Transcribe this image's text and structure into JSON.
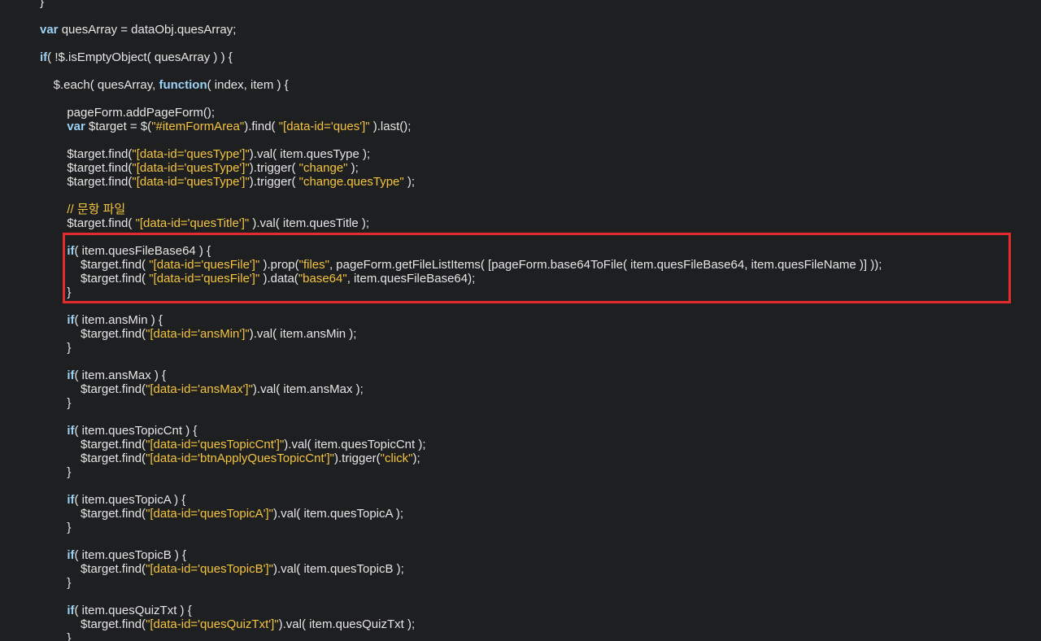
{
  "code_lines": [
    {
      "segments": [
        {
          "t": "}",
          "c": ""
        }
      ]
    },
    {
      "segments": []
    },
    {
      "segments": [
        {
          "t": "var",
          "c": "kw"
        },
        {
          "t": " quesArray = dataObj.quesArray;",
          "c": ""
        }
      ]
    },
    {
      "segments": []
    },
    {
      "segments": [
        {
          "t": "if",
          "c": "kw"
        },
        {
          "t": "( !$.isEmptyObject( quesArray ) ) {",
          "c": ""
        }
      ]
    },
    {
      "segments": []
    },
    {
      "segments": [
        {
          "t": "    $.each( quesArray, ",
          "c": ""
        },
        {
          "t": "function",
          "c": "kw"
        },
        {
          "t": "( index, item ) {",
          "c": ""
        }
      ]
    },
    {
      "segments": []
    },
    {
      "segments": [
        {
          "t": "        pageForm.addPageForm();",
          "c": ""
        }
      ]
    },
    {
      "segments": [
        {
          "t": "        ",
          "c": ""
        },
        {
          "t": "var",
          "c": "kw"
        },
        {
          "t": " $target = $(",
          "c": ""
        },
        {
          "t": "\"#itemFormArea\"",
          "c": "str"
        },
        {
          "t": ").find( ",
          "c": ""
        },
        {
          "t": "\"[data-id='ques']\"",
          "c": "str"
        },
        {
          "t": " ).last();",
          "c": ""
        }
      ]
    },
    {
      "segments": []
    },
    {
      "segments": [
        {
          "t": "        $target.find(",
          "c": ""
        },
        {
          "t": "\"[data-id='quesType']\"",
          "c": "str"
        },
        {
          "t": ").val( item.quesType );",
          "c": ""
        }
      ]
    },
    {
      "segments": [
        {
          "t": "        $target.find(",
          "c": ""
        },
        {
          "t": "\"[data-id='quesType']\"",
          "c": "str"
        },
        {
          "t": ").trigger( ",
          "c": ""
        },
        {
          "t": "\"change\"",
          "c": "str"
        },
        {
          "t": " );",
          "c": ""
        }
      ]
    },
    {
      "segments": [
        {
          "t": "        $target.find(",
          "c": ""
        },
        {
          "t": "\"[data-id='quesType']\"",
          "c": "str"
        },
        {
          "t": ").trigger( ",
          "c": ""
        },
        {
          "t": "\"change.quesType\"",
          "c": "str"
        },
        {
          "t": " );",
          "c": ""
        }
      ]
    },
    {
      "segments": []
    },
    {
      "segments": [
        {
          "t": "        // ",
          "c": "comment"
        },
        {
          "t": "문항 파일",
          "c": "comment kor"
        }
      ]
    },
    {
      "segments": [
        {
          "t": "        $target.find( ",
          "c": ""
        },
        {
          "t": "\"[data-id='quesTitle']\"",
          "c": "str"
        },
        {
          "t": " ).val( item.quesTitle );",
          "c": ""
        }
      ]
    },
    {
      "segments": []
    },
    {
      "segments": [
        {
          "t": "        ",
          "c": ""
        },
        {
          "t": "if",
          "c": "kw"
        },
        {
          "t": "( item.quesFileBase64 ) {",
          "c": ""
        }
      ]
    },
    {
      "segments": [
        {
          "t": "            $target.find( ",
          "c": ""
        },
        {
          "t": "\"[data-id='quesFile']\"",
          "c": "str"
        },
        {
          "t": " ).prop(",
          "c": ""
        },
        {
          "t": "\"files\"",
          "c": "str"
        },
        {
          "t": ", pageForm.getFileListItems( [pageForm.base64ToFile( item.quesFileBase64, item.quesFileName )] ));",
          "c": ""
        }
      ]
    },
    {
      "segments": [
        {
          "t": "            $target.find( ",
          "c": ""
        },
        {
          "t": "\"[data-id='quesFile']\"",
          "c": "str"
        },
        {
          "t": " ).data(",
          "c": ""
        },
        {
          "t": "\"base64\"",
          "c": "str"
        },
        {
          "t": ", item.quesFileBase64);",
          "c": ""
        }
      ]
    },
    {
      "segments": [
        {
          "t": "        }",
          "c": ""
        }
      ]
    },
    {
      "segments": []
    },
    {
      "segments": [
        {
          "t": "        ",
          "c": ""
        },
        {
          "t": "if",
          "c": "kw"
        },
        {
          "t": "( item.ansMin ) {",
          "c": ""
        }
      ]
    },
    {
      "segments": [
        {
          "t": "            $target.find(",
          "c": ""
        },
        {
          "t": "\"[data-id='ansMin']\"",
          "c": "str"
        },
        {
          "t": ").val( item.ansMin );",
          "c": ""
        }
      ]
    },
    {
      "segments": [
        {
          "t": "        }",
          "c": ""
        }
      ]
    },
    {
      "segments": []
    },
    {
      "segments": [
        {
          "t": "        ",
          "c": ""
        },
        {
          "t": "if",
          "c": "kw"
        },
        {
          "t": "( item.ansMax ) {",
          "c": ""
        }
      ]
    },
    {
      "segments": [
        {
          "t": "            $target.find(",
          "c": ""
        },
        {
          "t": "\"[data-id='ansMax']\"",
          "c": "str"
        },
        {
          "t": ").val( item.ansMax );",
          "c": ""
        }
      ]
    },
    {
      "segments": [
        {
          "t": "        }",
          "c": ""
        }
      ]
    },
    {
      "segments": []
    },
    {
      "segments": [
        {
          "t": "        ",
          "c": ""
        },
        {
          "t": "if",
          "c": "kw"
        },
        {
          "t": "( item.quesTopicCnt ) {",
          "c": ""
        }
      ]
    },
    {
      "segments": [
        {
          "t": "            $target.find(",
          "c": ""
        },
        {
          "t": "\"[data-id='quesTopicCnt']\"",
          "c": "str"
        },
        {
          "t": ").val( item.quesTopicCnt );",
          "c": ""
        }
      ]
    },
    {
      "segments": [
        {
          "t": "            $target.find(",
          "c": ""
        },
        {
          "t": "\"[data-id='btnApplyQuesTopicCnt']\"",
          "c": "str"
        },
        {
          "t": ").trigger(",
          "c": ""
        },
        {
          "t": "\"click\"",
          "c": "str"
        },
        {
          "t": ");",
          "c": ""
        }
      ]
    },
    {
      "segments": [
        {
          "t": "        }",
          "c": ""
        }
      ]
    },
    {
      "segments": []
    },
    {
      "segments": [
        {
          "t": "        ",
          "c": ""
        },
        {
          "t": "if",
          "c": "kw"
        },
        {
          "t": "( item.quesTopicA ) {",
          "c": ""
        }
      ]
    },
    {
      "segments": [
        {
          "t": "            $target.find(",
          "c": ""
        },
        {
          "t": "\"[data-id='quesTopicA']\"",
          "c": "str"
        },
        {
          "t": ").val( item.quesTopicA );",
          "c": ""
        }
      ]
    },
    {
      "segments": [
        {
          "t": "        }",
          "c": ""
        }
      ]
    },
    {
      "segments": []
    },
    {
      "segments": [
        {
          "t": "        ",
          "c": ""
        },
        {
          "t": "if",
          "c": "kw"
        },
        {
          "t": "( item.quesTopicB ) {",
          "c": ""
        }
      ]
    },
    {
      "segments": [
        {
          "t": "            $target.find(",
          "c": ""
        },
        {
          "t": "\"[data-id='quesTopicB']\"",
          "c": "str"
        },
        {
          "t": ").val( item.quesTopicB );",
          "c": ""
        }
      ]
    },
    {
      "segments": [
        {
          "t": "        }",
          "c": ""
        }
      ]
    },
    {
      "segments": []
    },
    {
      "segments": [
        {
          "t": "        ",
          "c": ""
        },
        {
          "t": "if",
          "c": "kw"
        },
        {
          "t": "( item.quesQuizTxt ) {",
          "c": ""
        }
      ]
    },
    {
      "segments": [
        {
          "t": "            $target.find(",
          "c": ""
        },
        {
          "t": "\"[data-id='quesQuizTxt']\"",
          "c": "str"
        },
        {
          "t": ").val( item.quesQuizTxt );",
          "c": ""
        }
      ]
    },
    {
      "segments": [
        {
          "t": "        }",
          "c": ""
        }
      ]
    }
  ],
  "colors": {
    "background": "#1e1f21",
    "text": "#e6e6e6",
    "keyword": "#9bd1f5",
    "string": "#f4c43f",
    "highlight_border": "#e32b2b"
  }
}
